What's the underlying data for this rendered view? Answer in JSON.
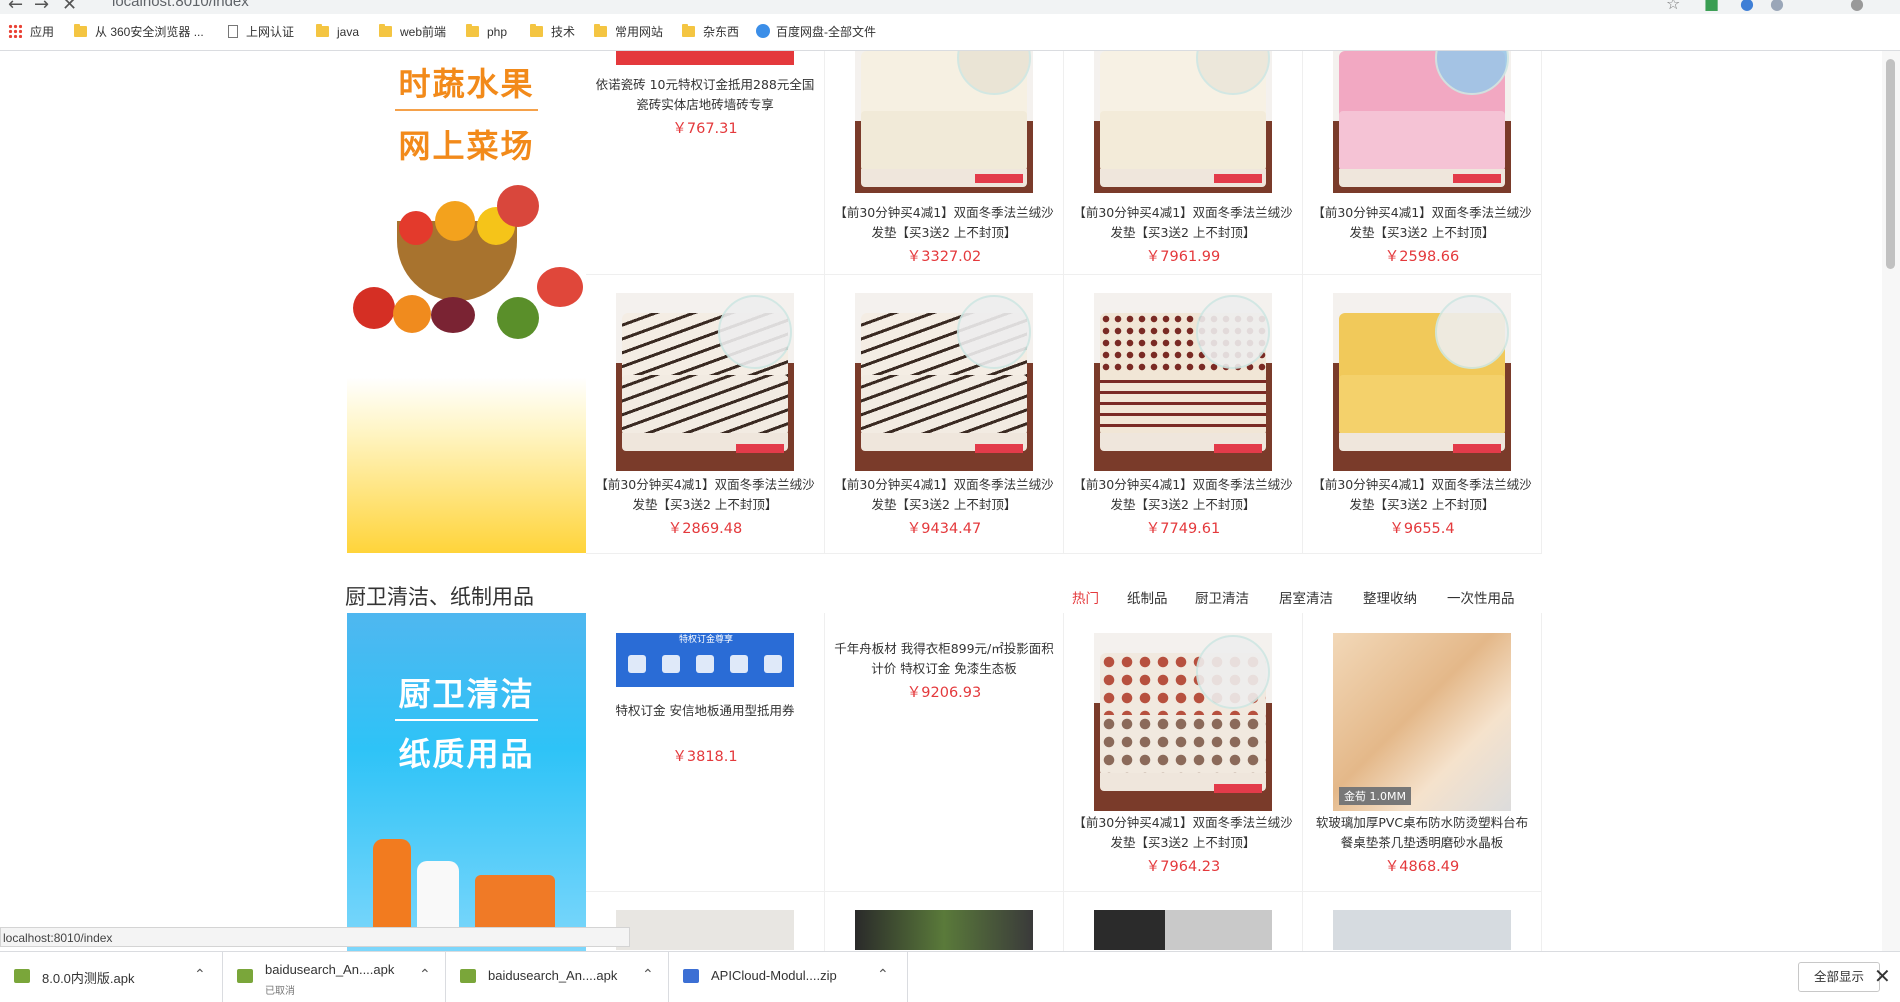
{
  "browser": {
    "url": "localhost:8010/index",
    "bookmarks": [
      {
        "label": "应用",
        "icon": "apps-grid-icon"
      },
      {
        "label": "从 360安全浏览器 ...",
        "icon": "folder-icon"
      },
      {
        "label": "上网认证",
        "icon": "page-icon"
      },
      {
        "label": "java",
        "icon": "folder-icon"
      },
      {
        "label": "web前端",
        "icon": "folder-icon"
      },
      {
        "label": "php",
        "icon": "folder-icon"
      },
      {
        "label": "技术",
        "icon": "folder-icon"
      },
      {
        "label": "常用网站",
        "icon": "folder-icon"
      },
      {
        "label": "杂东西",
        "icon": "folder-icon"
      },
      {
        "label": "百度网盘-全部文件",
        "icon": "baidu-cloud-icon"
      }
    ]
  },
  "banners": {
    "fruit": {
      "line1": "时蔬水果",
      "line2": "网上菜场"
    },
    "clean": {
      "line1": "厨卫清洁",
      "line2": "纸质用品"
    }
  },
  "section1": {
    "products": [
      {
        "name": "依诺瓷砖 10元特权订金抵用288元全国瓷砖实体店地砖墙砖专享",
        "price": "￥767.31"
      },
      {
        "name": "【前30分钟买4减1】双面冬季法兰绒沙发垫【买3送2 上不封顶】",
        "price": "￥3327.02"
      },
      {
        "name": "【前30分钟买4减1】双面冬季法兰绒沙发垫【买3送2 上不封顶】",
        "price": "￥7961.99"
      },
      {
        "name": "【前30分钟买4减1】双面冬季法兰绒沙发垫【买3送2 上不封顶】",
        "price": "￥2598.66"
      },
      {
        "name": "【前30分钟买4减1】双面冬季法兰绒沙发垫【买3送2 上不封顶】",
        "price": "￥2869.48"
      },
      {
        "name": "【前30分钟买4减1】双面冬季法兰绒沙发垫【买3送2 上不封顶】",
        "price": "￥9434.47"
      },
      {
        "name": "【前30分钟买4减1】双面冬季法兰绒沙发垫【买3送2 上不封顶】",
        "price": "￥7749.61"
      },
      {
        "name": "【前30分钟买4减1】双面冬季法兰绒沙发垫【买3送2 上不封顶】",
        "price": "￥9655.4"
      }
    ]
  },
  "section2": {
    "title": "厨卫清洁、纸制用品",
    "tabs": [
      "热门",
      "纸制品",
      "厨卫清洁",
      "居室清洁",
      "整理收纳",
      "一次性用品"
    ],
    "coupon_banner_text": "特权订金尊享",
    "products": [
      {
        "name": "特权订金 安信地板通用型抵用券",
        "price": "￥3818.1"
      },
      {
        "name": "千年舟板材 我得衣柜899元/㎡投影面积计价 特权订金 免漆生态板",
        "price": "￥9206.93"
      },
      {
        "name": "【前30分钟买4减1】双面冬季法兰绒沙发垫【买3送2 上不封顶】",
        "price": "￥7964.23"
      },
      {
        "name": "软玻璃加厚PVC桌布防水防烫塑料台布餐桌垫茶几垫透明磨砂水晶板",
        "price": "￥4868.49",
        "image_label": "金荀 1.0MM"
      }
    ]
  },
  "status_bar": "localhost:8010/index",
  "downloads": [
    {
      "file": "8.0.0内测版.apk",
      "status": ""
    },
    {
      "file": "baidusearch_An....apk",
      "status": "已取消"
    },
    {
      "file": "baidusearch_An....apk",
      "status": ""
    },
    {
      "file": "APICloud-Modul....zip",
      "status": ""
    }
  ],
  "show_all_label": "全部显示"
}
